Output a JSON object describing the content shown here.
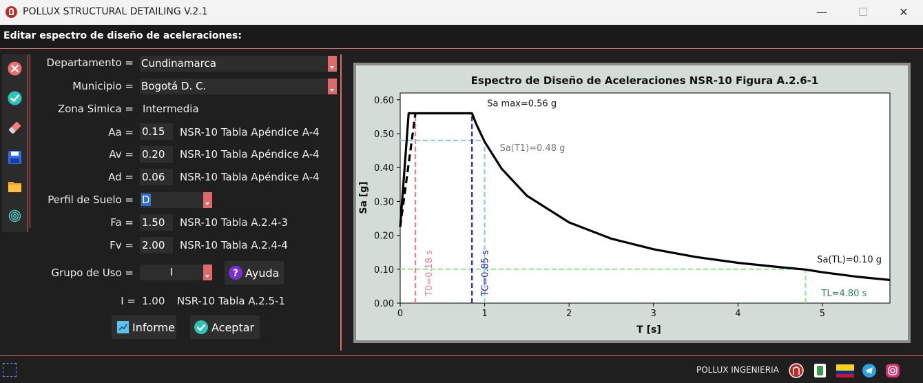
{
  "window": {
    "title": "POLLUX STRUCTURAL DETAILING V.2.1",
    "minimize_glyph": "—",
    "maximize_glyph": "☐",
    "close_glyph": "✕"
  },
  "header": {
    "title": "Editar espectro de diseño de aceleraciones:"
  },
  "toolbar": {
    "icons": [
      "close-circle-icon",
      "check-circle-icon",
      "eraser-icon",
      "save-icon",
      "folder-icon",
      "fingerprint-icon"
    ]
  },
  "form": {
    "departamento": {
      "label": "Departamento =",
      "value": "Cundinamarca"
    },
    "municipio": {
      "label": "Municipio =",
      "value": "Bogotá D. C."
    },
    "zona": {
      "label": "Zona Simica =",
      "value": "Intermedia"
    },
    "aa": {
      "label": "Aa =",
      "value": "0.15",
      "ref": "NSR-10 Tabla Apéndice A-4"
    },
    "av": {
      "label": "Av =",
      "value": "0.20",
      "ref": "NSR-10 Tabla Apéndice A-4"
    },
    "ad": {
      "label": "Ad =",
      "value": "0.06",
      "ref": "NSR-10 Tabla Apéndice A-4"
    },
    "perfil": {
      "label": "Perfil de Suelo =",
      "value": "D"
    },
    "fa": {
      "label": "Fa =",
      "value": "1.50",
      "ref": "NSR-10 Tabla A.2.4-3"
    },
    "fv": {
      "label": "Fv =",
      "value": "2.00",
      "ref": "NSR-10 Tabla A.2.4-4"
    },
    "grupo": {
      "label": "Grupo de Uso =",
      "value": "I"
    },
    "ayuda_label": "Ayuda",
    "i_label": "I =",
    "i_value": "1.00",
    "i_ref": "NSR-10 Tabla A.2.5-1",
    "informe_label": "Informe",
    "aceptar_label": "Aceptar"
  },
  "chart_data": {
    "type": "line",
    "title": "Espectro de Diseño de Aceleraciones NSR-10 Figura A.2.6-1",
    "xlabel": "T [s]",
    "ylabel": "Sa [g]",
    "xlim": [
      0,
      5.8
    ],
    "ylim": [
      0,
      0.62
    ],
    "xticks": [
      0,
      1,
      2,
      3,
      4,
      5
    ],
    "yticks": [
      0.0,
      0.1,
      0.2,
      0.3,
      0.4,
      0.5,
      0.6
    ],
    "grid": false,
    "params": {
      "T0": 0.18,
      "TC": 0.85,
      "TL": 4.8,
      "Samax": 0.56,
      "SaT1": 0.48,
      "SaTL": 0.1
    },
    "series": [
      {
        "style": "dashed",
        "color": "#000000",
        "x": [
          0.0,
          0.18
        ],
        "y": [
          0.225,
          0.56
        ]
      },
      {
        "style": "solid",
        "color": "#000000",
        "x": [
          0.0,
          0.1,
          0.18,
          0.3,
          0.5,
          0.7,
          0.85,
          0.9,
          1.0,
          1.2,
          1.5,
          2.0,
          2.5,
          3.0,
          3.5,
          4.0,
          4.5,
          4.8,
          5.0,
          5.4,
          5.8
        ],
        "y": [
          0.225,
          0.56,
          0.56,
          0.56,
          0.56,
          0.56,
          0.56,
          0.529,
          0.476,
          0.397,
          0.317,
          0.238,
          0.19,
          0.159,
          0.136,
          0.119,
          0.106,
          0.099,
          0.091,
          0.078,
          0.068
        ]
      }
    ],
    "guides": [
      {
        "type": "vline",
        "x": 0.18,
        "y_top": 0.56,
        "color": "#f08080",
        "label": "T0=0.18 s"
      },
      {
        "type": "vline",
        "x": 0.85,
        "y_top": 0.56,
        "color": "#1a1adc",
        "label": "TC=0.85 s"
      },
      {
        "type": "vline",
        "x": 1.0,
        "y_top": 0.48,
        "color": "#87ceeb",
        "label": ""
      },
      {
        "type": "hline",
        "y": 0.48,
        "x_end": 1.0,
        "color": "#87ceeb",
        "label": "Sa(T1)=0.48 g"
      },
      {
        "type": "hline",
        "y": 0.1,
        "x_end": 4.8,
        "color": "#90ee90",
        "label": ""
      },
      {
        "type": "vline",
        "x": 4.8,
        "y_top": 0.1,
        "color": "#90ee90",
        "label": "TL=4.80 s"
      }
    ],
    "annotations": [
      "Sa max=0.56 g",
      "Sa(TL)=0.10 g"
    ],
    "colors": {
      "curve": "#000000",
      "t0": "#f08080",
      "tc": "#1a1adc",
      "t1": "#87ceeb",
      "tl": "#90ee90",
      "tl_text": "#2e8b57",
      "t1_text": "#7a7a7a"
    }
  },
  "footer": {
    "label": "POLLUX INGENIERIA",
    "icons": [
      "pollux-logo-icon",
      "document-icon",
      "colombia-flag-icon",
      "telegram-icon",
      "instagram-icon"
    ]
  }
}
